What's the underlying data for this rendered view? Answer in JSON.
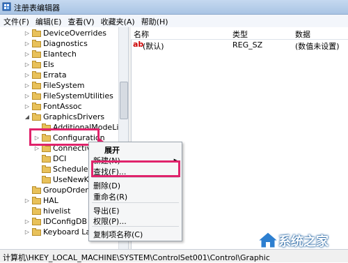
{
  "window": {
    "title": "注册表编辑器"
  },
  "menu": [
    "文件(F)",
    "编辑(E)",
    "查看(V)",
    "收藏夹(A)",
    "帮助(H)"
  ],
  "tree": [
    {
      "label": "DeviceOverrides",
      "expander": "▷"
    },
    {
      "label": "Diagnostics",
      "expander": "▷"
    },
    {
      "label": "Elantech",
      "expander": "▷"
    },
    {
      "label": "Els",
      "expander": "▷"
    },
    {
      "label": "Errata",
      "expander": "▷"
    },
    {
      "label": "FileSystem",
      "expander": "▷"
    },
    {
      "label": "FileSystemUtilities",
      "expander": "▷"
    },
    {
      "label": "FontAssoc",
      "expander": "▷"
    },
    {
      "label": "GraphicsDrivers",
      "expander": "◢"
    },
    {
      "label": "AdditionalModeLists",
      "expander": ""
    },
    {
      "label": "Configuration",
      "expander": "▷"
    },
    {
      "label": "Connectivity",
      "expander": "▷"
    },
    {
      "label": "DCI",
      "expander": ""
    },
    {
      "label": "Scheduler",
      "expander": ""
    },
    {
      "label": "UseNewKey",
      "expander": ""
    },
    {
      "label": "GroupOrderList",
      "expander": ""
    },
    {
      "label": "HAL",
      "expander": "▷"
    },
    {
      "label": "hivelist",
      "expander": ""
    },
    {
      "label": "IDConfigDB",
      "expander": "▷"
    },
    {
      "label": "Keyboard Layout",
      "expander": "▷"
    }
  ],
  "list": {
    "headers": {
      "name": "名称",
      "type": "类型",
      "data": "数据"
    },
    "rows": [
      {
        "icon": "ab",
        "name": "(默认)",
        "type": "REG_SZ",
        "data": "(数值未设置)"
      }
    ]
  },
  "context_menu": [
    "展开",
    "新建(N)",
    "查找(F)...",
    "删除(D)",
    "重命名(R)",
    "导出(E)",
    "权限(P)...",
    "复制项名称(C)"
  ],
  "status_path": "计算机\\HKEY_LOCAL_MACHINE\\SYSTEM\\ControlSet001\\Control\\Graphic",
  "watermark_text": "系统之家",
  "colors": {
    "highlight": "#e0236b",
    "titlebar": "#b7cfea"
  }
}
